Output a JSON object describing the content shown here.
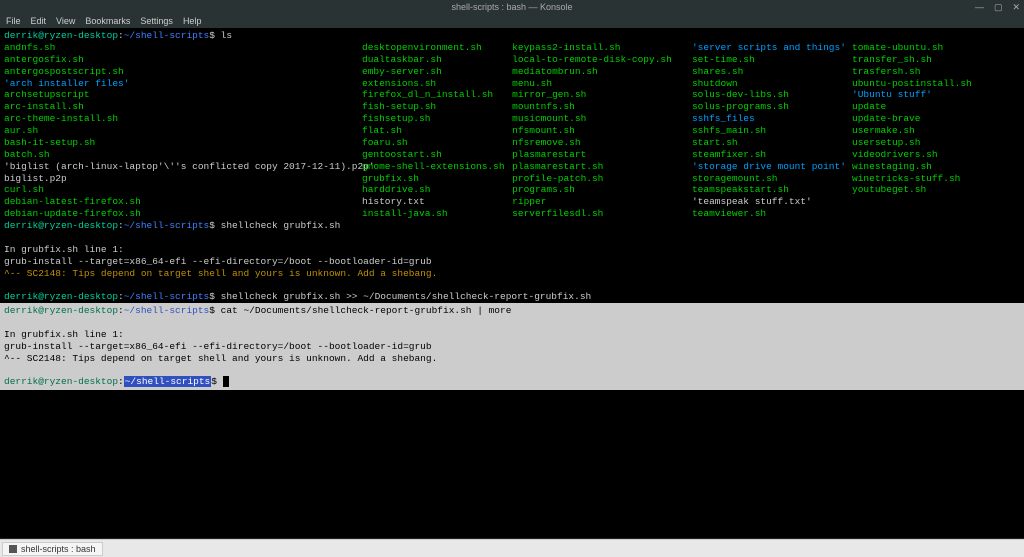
{
  "window": {
    "title": "shell-scripts : bash — Konsole"
  },
  "win_controls": {
    "min": "—",
    "max": "▢",
    "close": "✕"
  },
  "menu": {
    "file": "File",
    "edit": "Edit",
    "view": "View",
    "bookmarks": "Bookmarks",
    "settings": "Settings",
    "help": "Help"
  },
  "ps1": {
    "user_host": "derrik@ryzen-desktop",
    "path": "~/shell-scripts",
    "dollar": "$"
  },
  "cmds": {
    "ls": "ls",
    "shellcheck1": "shellcheck grubfix.sh",
    "shellcheck2": "shellcheck grubfix.sh >> ~/Documents/shellcheck-report-grubfix.sh",
    "cat": "cat ~/Documents/shellcheck-report-grubfix.sh | more"
  },
  "ls": {
    "col1": [
      {
        "t": "andnfs.sh",
        "c": "exec"
      },
      {
        "t": "antergosfix.sh",
        "c": "exec"
      },
      {
        "t": "antergospostscript.sh",
        "c": "exec"
      },
      {
        "t": "'arch installer files'",
        "c": "dir"
      },
      {
        "t": "archsetupscript",
        "c": "exec"
      },
      {
        "t": "arc-install.sh",
        "c": "exec"
      },
      {
        "t": "arc-theme-install.sh",
        "c": "exec"
      },
      {
        "t": "aur.sh",
        "c": "exec"
      },
      {
        "t": "bash-it-setup.sh",
        "c": "exec"
      },
      {
        "t": "batch.sh",
        "c": "exec"
      },
      {
        "t": "'biglist (arch-linux-laptop'\\''s conflicted copy 2017-12-11).p2p'",
        "c": "regular"
      },
      {
        "t": "biglist.p2p",
        "c": "regular"
      },
      {
        "t": "curl.sh",
        "c": "exec"
      },
      {
        "t": "debian-latest-firefox.sh",
        "c": "exec"
      },
      {
        "t": "debian-update-firefox.sh",
        "c": "exec"
      }
    ],
    "col2": [
      {
        "t": "desktopenvironment.sh",
        "c": "exec"
      },
      {
        "t": "dualtaskbar.sh",
        "c": "exec"
      },
      {
        "t": "emby-server.sh",
        "c": "exec"
      },
      {
        "t": "extensions.sh",
        "c": "exec"
      },
      {
        "t": "firefox_dl_n_install.sh",
        "c": "exec"
      },
      {
        "t": "fish-setup.sh",
        "c": "exec"
      },
      {
        "t": "fishsetup.sh",
        "c": "exec"
      },
      {
        "t": "flat.sh",
        "c": "exec"
      },
      {
        "t": "foaru.sh",
        "c": "exec"
      },
      {
        "t": "gentoostart.sh",
        "c": "exec"
      },
      {
        "t": "gnome-shell-extensions.sh",
        "c": "exec"
      },
      {
        "t": "grubfix.sh",
        "c": "exec"
      },
      {
        "t": "harddrive.sh",
        "c": "exec"
      },
      {
        "t": "history.txt",
        "c": "regular"
      },
      {
        "t": "install-java.sh",
        "c": "exec"
      }
    ],
    "col3": [
      {
        "t": "keypass2-install.sh",
        "c": "exec"
      },
      {
        "t": "local-to-remote-disk-copy.sh",
        "c": "exec"
      },
      {
        "t": "mediatombrun.sh",
        "c": "exec"
      },
      {
        "t": "menu.sh",
        "c": "exec"
      },
      {
        "t": "mirror_gen.sh",
        "c": "exec"
      },
      {
        "t": "mountnfs.sh",
        "c": "exec"
      },
      {
        "t": "musicmount.sh",
        "c": "exec"
      },
      {
        "t": "nfsmount.sh",
        "c": "exec"
      },
      {
        "t": "nfsremove.sh",
        "c": "exec"
      },
      {
        "t": "plasmarestart",
        "c": "exec"
      },
      {
        "t": "plasmarestart.sh",
        "c": "exec"
      },
      {
        "t": "profile-patch.sh",
        "c": "exec"
      },
      {
        "t": "programs.sh",
        "c": "exec"
      },
      {
        "t": "ripper",
        "c": "exec"
      },
      {
        "t": "serverfilesdl.sh",
        "c": "exec"
      }
    ],
    "col4": [
      {
        "t": "'server scripts and things'",
        "c": "dir"
      },
      {
        "t": "set-time.sh",
        "c": "exec"
      },
      {
        "t": "shares.sh",
        "c": "exec"
      },
      {
        "t": "shutdown",
        "c": "exec"
      },
      {
        "t": "solus-dev-libs.sh",
        "c": "exec"
      },
      {
        "t": "solus-programs.sh",
        "c": "exec"
      },
      {
        "t": "sshfs_files",
        "c": "dir"
      },
      {
        "t": "sshfs_main.sh",
        "c": "exec"
      },
      {
        "t": "start.sh",
        "c": "exec"
      },
      {
        "t": "steamfixer.sh",
        "c": "exec"
      },
      {
        "t": "'storage drive mount point'",
        "c": "dir"
      },
      {
        "t": "storagemount.sh",
        "c": "exec"
      },
      {
        "t": "teamspeakstart.sh",
        "c": "exec"
      },
      {
        "t": "'teamspeak stuff.txt'",
        "c": "regular"
      },
      {
        "t": "teamviewer.sh",
        "c": "exec"
      }
    ],
    "col5": [
      {
        "t": "tomate-ubuntu.sh",
        "c": "exec"
      },
      {
        "t": "transfer_sh.sh",
        "c": "exec"
      },
      {
        "t": "trasfersh.sh",
        "c": "exec"
      },
      {
        "t": "ubuntu-postinstall.sh",
        "c": "exec"
      },
      {
        "t": "'Ubuntu stuff'",
        "c": "dir"
      },
      {
        "t": "update",
        "c": "exec"
      },
      {
        "t": "update-brave",
        "c": "exec"
      },
      {
        "t": "usermake.sh",
        "c": "exec"
      },
      {
        "t": "usersetup.sh",
        "c": "exec"
      },
      {
        "t": "videodrivers.sh",
        "c": "exec"
      },
      {
        "t": "winestaging.sh",
        "c": "exec"
      },
      {
        "t": "winetricks-stuff.sh",
        "c": "exec"
      },
      {
        "t": "youtubeget.sh",
        "c": "exec"
      }
    ]
  },
  "shellcheck_out": {
    "line1": "In grubfix.sh line 1:",
    "line2": "grub-install --target=x86_64-efi --efi-directory=/boot --bootloader-id=grub",
    "line3": "^-- SC2148: Tips depend on target shell and yours is unknown. Add a shebang."
  },
  "taskbar": {
    "item": "shell-scripts : bash"
  }
}
